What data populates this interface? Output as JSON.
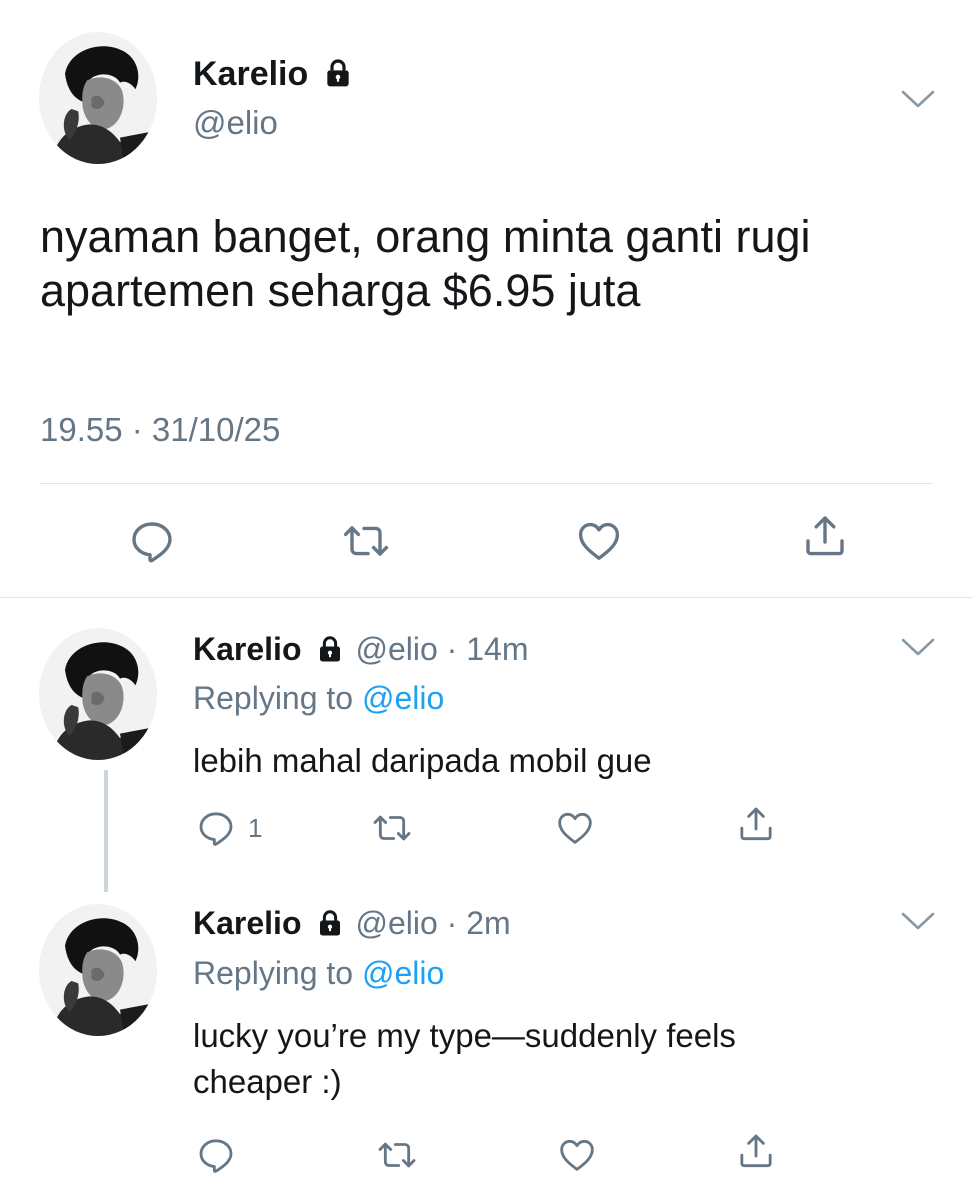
{
  "main_tweet": {
    "display_name": "Karelio",
    "handle": "@elio",
    "text_line1": "nyaman banget, orang minta ganti rugi",
    "text_line2": "apartemen seharga $6.95 juta",
    "timestamp": "19.55 · 31/10/25",
    "icons": [
      "lock-icon",
      "chevron-down-icon",
      "reply-icon",
      "retweet-icon",
      "like-icon",
      "share-icon"
    ]
  },
  "replies": [
    {
      "display_name": "Karelio",
      "handle_time": "@elio · 14m",
      "replying_prefix": "Replying to ",
      "replying_to": "@elio",
      "text_line1": "lebih mahal daripada mobil gue",
      "text_line2": "",
      "reply_count": "1"
    },
    {
      "display_name": "Karelio",
      "handle_time": "@elio · 2m",
      "replying_prefix": "Replying to ",
      "replying_to": "@elio",
      "text_line1": "lucky you’re my type—suddenly feels",
      "text_line2": "cheaper :)",
      "reply_count": ""
    }
  ],
  "colors": {
    "text": "#14171a",
    "secondary": "#657786",
    "accent": "#1da1f2",
    "divider": "#e1e8ed"
  }
}
